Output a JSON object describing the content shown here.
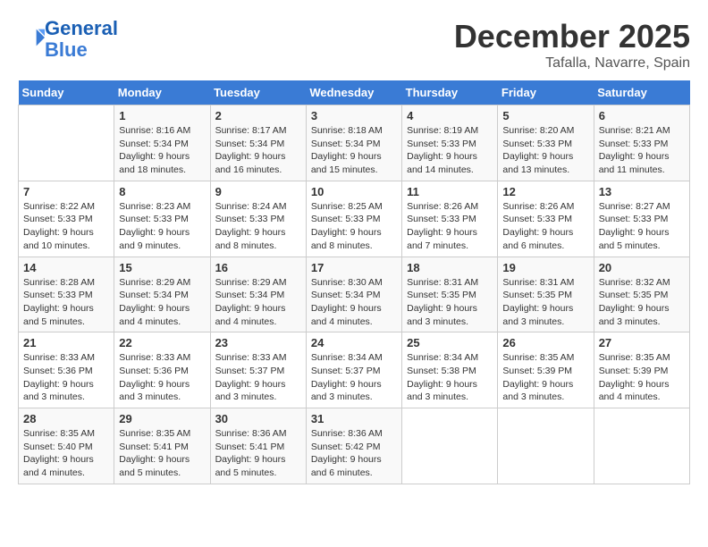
{
  "header": {
    "logo_line1": "General",
    "logo_line2": "Blue",
    "month": "December 2025",
    "location": "Tafalla, Navarre, Spain"
  },
  "days_of_week": [
    "Sunday",
    "Monday",
    "Tuesday",
    "Wednesday",
    "Thursday",
    "Friday",
    "Saturday"
  ],
  "weeks": [
    [
      {
        "day": "",
        "info": ""
      },
      {
        "day": "1",
        "info": "Sunrise: 8:16 AM\nSunset: 5:34 PM\nDaylight: 9 hours\nand 18 minutes."
      },
      {
        "day": "2",
        "info": "Sunrise: 8:17 AM\nSunset: 5:34 PM\nDaylight: 9 hours\nand 16 minutes."
      },
      {
        "day": "3",
        "info": "Sunrise: 8:18 AM\nSunset: 5:34 PM\nDaylight: 9 hours\nand 15 minutes."
      },
      {
        "day": "4",
        "info": "Sunrise: 8:19 AM\nSunset: 5:33 PM\nDaylight: 9 hours\nand 14 minutes."
      },
      {
        "day": "5",
        "info": "Sunrise: 8:20 AM\nSunset: 5:33 PM\nDaylight: 9 hours\nand 13 minutes."
      },
      {
        "day": "6",
        "info": "Sunrise: 8:21 AM\nSunset: 5:33 PM\nDaylight: 9 hours\nand 11 minutes."
      }
    ],
    [
      {
        "day": "7",
        "info": "Sunrise: 8:22 AM\nSunset: 5:33 PM\nDaylight: 9 hours\nand 10 minutes."
      },
      {
        "day": "8",
        "info": "Sunrise: 8:23 AM\nSunset: 5:33 PM\nDaylight: 9 hours\nand 9 minutes."
      },
      {
        "day": "9",
        "info": "Sunrise: 8:24 AM\nSunset: 5:33 PM\nDaylight: 9 hours\nand 8 minutes."
      },
      {
        "day": "10",
        "info": "Sunrise: 8:25 AM\nSunset: 5:33 PM\nDaylight: 9 hours\nand 8 minutes."
      },
      {
        "day": "11",
        "info": "Sunrise: 8:26 AM\nSunset: 5:33 PM\nDaylight: 9 hours\nand 7 minutes."
      },
      {
        "day": "12",
        "info": "Sunrise: 8:26 AM\nSunset: 5:33 PM\nDaylight: 9 hours\nand 6 minutes."
      },
      {
        "day": "13",
        "info": "Sunrise: 8:27 AM\nSunset: 5:33 PM\nDaylight: 9 hours\nand 5 minutes."
      }
    ],
    [
      {
        "day": "14",
        "info": "Sunrise: 8:28 AM\nSunset: 5:33 PM\nDaylight: 9 hours\nand 5 minutes."
      },
      {
        "day": "15",
        "info": "Sunrise: 8:29 AM\nSunset: 5:34 PM\nDaylight: 9 hours\nand 4 minutes."
      },
      {
        "day": "16",
        "info": "Sunrise: 8:29 AM\nSunset: 5:34 PM\nDaylight: 9 hours\nand 4 minutes."
      },
      {
        "day": "17",
        "info": "Sunrise: 8:30 AM\nSunset: 5:34 PM\nDaylight: 9 hours\nand 4 minutes."
      },
      {
        "day": "18",
        "info": "Sunrise: 8:31 AM\nSunset: 5:35 PM\nDaylight: 9 hours\nand 3 minutes."
      },
      {
        "day": "19",
        "info": "Sunrise: 8:31 AM\nSunset: 5:35 PM\nDaylight: 9 hours\nand 3 minutes."
      },
      {
        "day": "20",
        "info": "Sunrise: 8:32 AM\nSunset: 5:35 PM\nDaylight: 9 hours\nand 3 minutes."
      }
    ],
    [
      {
        "day": "21",
        "info": "Sunrise: 8:33 AM\nSunset: 5:36 PM\nDaylight: 9 hours\nand 3 minutes."
      },
      {
        "day": "22",
        "info": "Sunrise: 8:33 AM\nSunset: 5:36 PM\nDaylight: 9 hours\nand 3 minutes."
      },
      {
        "day": "23",
        "info": "Sunrise: 8:33 AM\nSunset: 5:37 PM\nDaylight: 9 hours\nand 3 minutes."
      },
      {
        "day": "24",
        "info": "Sunrise: 8:34 AM\nSunset: 5:37 PM\nDaylight: 9 hours\nand 3 minutes."
      },
      {
        "day": "25",
        "info": "Sunrise: 8:34 AM\nSunset: 5:38 PM\nDaylight: 9 hours\nand 3 minutes."
      },
      {
        "day": "26",
        "info": "Sunrise: 8:35 AM\nSunset: 5:39 PM\nDaylight: 9 hours\nand 3 minutes."
      },
      {
        "day": "27",
        "info": "Sunrise: 8:35 AM\nSunset: 5:39 PM\nDaylight: 9 hours\nand 4 minutes."
      }
    ],
    [
      {
        "day": "28",
        "info": "Sunrise: 8:35 AM\nSunset: 5:40 PM\nDaylight: 9 hours\nand 4 minutes."
      },
      {
        "day": "29",
        "info": "Sunrise: 8:35 AM\nSunset: 5:41 PM\nDaylight: 9 hours\nand 5 minutes."
      },
      {
        "day": "30",
        "info": "Sunrise: 8:36 AM\nSunset: 5:41 PM\nDaylight: 9 hours\nand 5 minutes."
      },
      {
        "day": "31",
        "info": "Sunrise: 8:36 AM\nSunset: 5:42 PM\nDaylight: 9 hours\nand 6 minutes."
      },
      {
        "day": "",
        "info": ""
      },
      {
        "day": "",
        "info": ""
      },
      {
        "day": "",
        "info": ""
      }
    ]
  ]
}
